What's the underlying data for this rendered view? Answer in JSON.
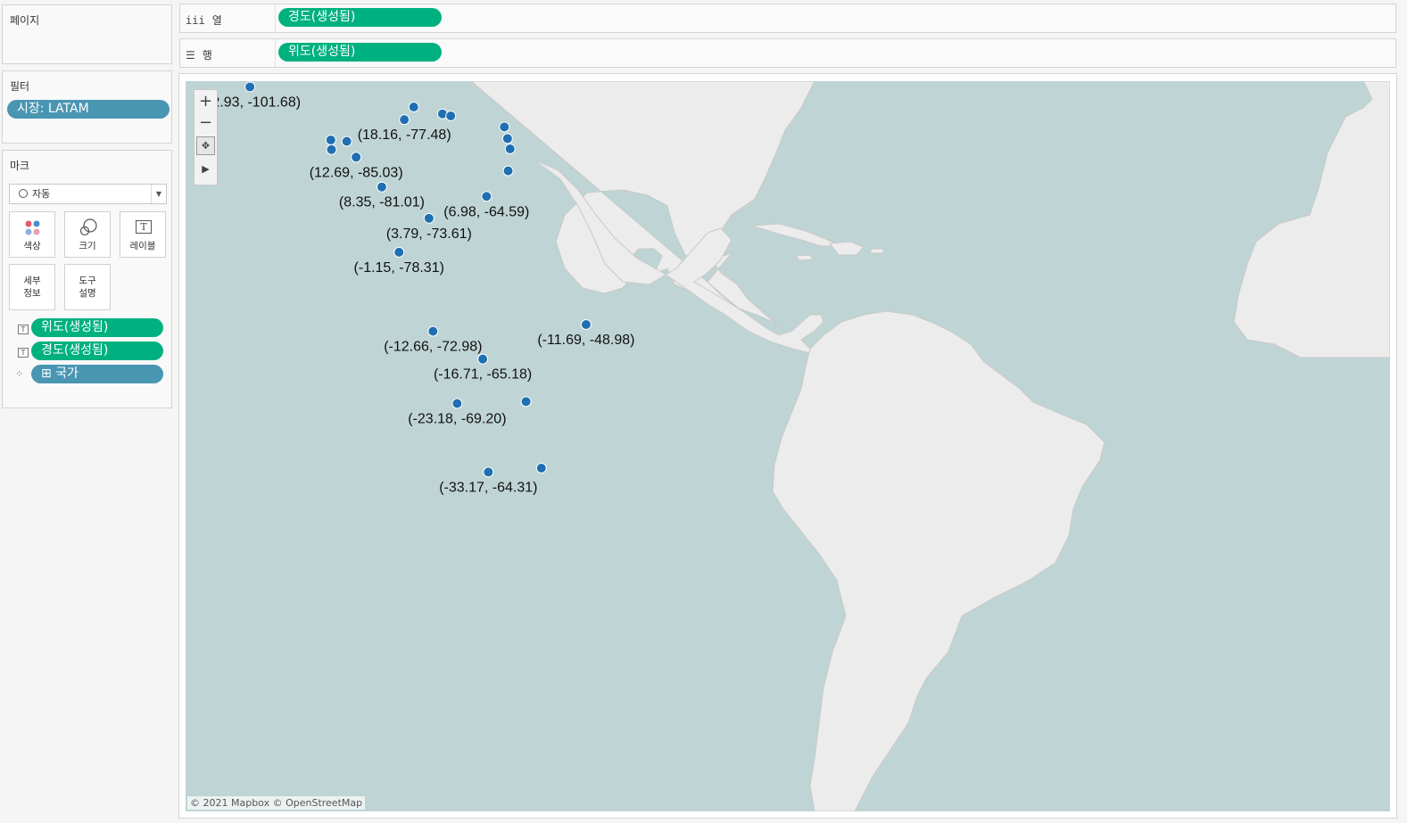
{
  "pages_card": {
    "title": "페이지"
  },
  "filters_card": {
    "title": "필터",
    "filter_pill": "시장: LATAM"
  },
  "marks_card": {
    "title": "마크",
    "mark_type": "자동",
    "buttons": {
      "color": "색상",
      "size": "크기",
      "label": "레이블",
      "detail_1": "세부",
      "detail_2": "정보",
      "tooltip_1": "도구",
      "tooltip_2": "설명"
    },
    "pills": [
      {
        "type_icon": "T",
        "label": "위도(생성됨)"
      },
      {
        "type_icon": "T",
        "label": "경도(생성됨)"
      },
      {
        "type_icon": "⁘",
        "label": "⊞ 국가"
      }
    ]
  },
  "columns_shelf": {
    "label": "열",
    "pill": "경도(생성됨)"
  },
  "rows_shelf": {
    "label": "행",
    "pill": "위도(생성됨)"
  },
  "map": {
    "credit": "© 2021 Mapbox © OpenStreetMap",
    "colors": {
      "water": "#bfd4d4",
      "land": "#ececec",
      "point": "#1f6fb2",
      "border": "#c9c9c9"
    },
    "labels": [
      "(22.93, -101.68)",
      "(18.16, -77.48)",
      "(12.69, -85.03)",
      "(8.35, -81.01)",
      "(6.98, -64.59)",
      "(3.79, -73.61)",
      "(-1.15, -78.31)",
      "(-12.66, -72.98)",
      "(-11.69, -48.98)",
      "(-16.71, -65.18)",
      "(-23.18, -69.20)",
      "(-33.17, -64.31)"
    ],
    "points": [
      {
        "lat": 22.93,
        "lon": -101.68,
        "label_index": 0
      },
      {
        "lat": 18.16,
        "lon": -77.48,
        "label_index": 1
      },
      {
        "lat": 12.69,
        "lon": -85.03,
        "label_index": 2
      },
      {
        "lat": 8.35,
        "lon": -81.01,
        "label_index": 3
      },
      {
        "lat": 6.98,
        "lon": -64.59,
        "label_index": 4
      },
      {
        "lat": 3.79,
        "lon": -73.61,
        "label_index": 5
      },
      {
        "lat": -1.15,
        "lon": -78.31,
        "label_index": 6
      },
      {
        "lat": -12.66,
        "lon": -72.98,
        "label_index": 7
      },
      {
        "lat": -11.69,
        "lon": -48.98,
        "label_index": 8
      },
      {
        "lat": -16.71,
        "lon": -65.18,
        "label_index": 9
      },
      {
        "lat": -23.18,
        "lon": -69.2,
        "label_index": 10
      },
      {
        "lat": -33.17,
        "lon": -64.31,
        "label_index": 11
      },
      {
        "lat": 20.0,
        "lon": -76.0
      },
      {
        "lat": 19.0,
        "lon": -71.5
      },
      {
        "lat": 18.7,
        "lon": -70.2
      },
      {
        "lat": 15.2,
        "lon": -89.0
      },
      {
        "lat": 13.8,
        "lon": -88.9
      },
      {
        "lat": 15.0,
        "lon": -86.5
      },
      {
        "lat": 17.1,
        "lon": -61.8
      },
      {
        "lat": 15.4,
        "lon": -61.3
      },
      {
        "lat": 13.9,
        "lon": -60.9
      },
      {
        "lat": 10.7,
        "lon": -61.2
      },
      {
        "lat": -22.9,
        "lon": -58.4
      },
      {
        "lat": -32.6,
        "lon": -56.0
      }
    ]
  }
}
